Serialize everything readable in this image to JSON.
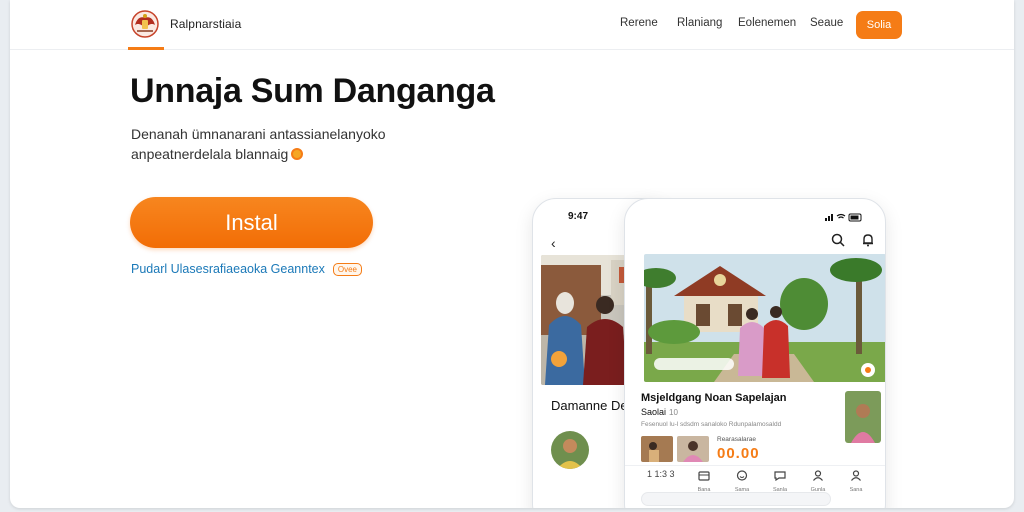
{
  "header": {
    "brand": "Ralpnarstiaia",
    "nav": [
      "Rerene",
      "Rlaniang",
      "Eolenemen",
      "Seaue"
    ],
    "cta": "Solia"
  },
  "hero": {
    "title": "Unnaja Sum Danganga",
    "subtitle_line1": "Denanah ümnanarani antassianelanyoko",
    "subtitle_line2": "anpeatnerdelala blannaig",
    "install_label": "Instal",
    "link_text": "Pudarl Ulasesrafiaeaoka Geanntex",
    "link_badge": "Ovee"
  },
  "phone_back": {
    "time": "9:47",
    "heading": "Damanne Dea"
  },
  "phone_front": {
    "post_title": "Msjeldgang Noan Sapelajan",
    "post_subtitle": "Saolai",
    "post_subtitle_meta": "10",
    "post_line": "Fesenuol lu-l sdsdm sanaloko Rdunpalamosaldd",
    "amount_label": "Rearasalarae",
    "amount": "00.00",
    "stat": "1 1:3 3",
    "tabs": [
      "Bana",
      "Sama",
      "Sanla",
      "Gunla",
      "Sana"
    ]
  },
  "colors": {
    "accent": "#f57c16",
    "link": "#1b79b8"
  },
  "icons": {
    "logo": "emblem-icon",
    "back": "back-arrow-icon",
    "search": "search-icon",
    "notification": "bell-icon",
    "signal": "signal-icon",
    "wifi": "wifi-icon",
    "battery": "battery-icon"
  }
}
